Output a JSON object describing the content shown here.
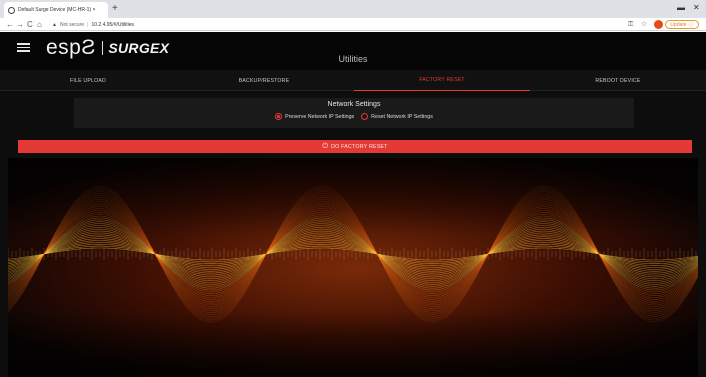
{
  "browser": {
    "tab_title": "Default Surge Device (MC-HR-1) ×",
    "tab_close": "×",
    "new_tab": "+",
    "window_min": "▬",
    "window_close": "✕",
    "nav_back": "←",
    "nav_forward": "→",
    "nav_reload": "C",
    "nav_home": "⌂",
    "security_icon": "▲",
    "security_label": "Not secure",
    "url": "10.2.4.95/#/Utilities",
    "update_label": "Update"
  },
  "header": {
    "logo_esp": "espƧ",
    "logo_surgex": "SURGEX",
    "title": "Utilities"
  },
  "nav": {
    "tabs": [
      {
        "label": "FILE UPLOAD"
      },
      {
        "label": "BACKUP/RESTORE"
      },
      {
        "label": "FACTORY RESET"
      },
      {
        "label": "REBOOT DEVICE"
      }
    ],
    "active_index": 2
  },
  "network_settings": {
    "heading": "Network Settings",
    "options": [
      {
        "label": "Preserve Network IP Settings",
        "selected": true
      },
      {
        "label": "Reset Network IP Settings",
        "selected": false
      }
    ]
  },
  "action": {
    "icon": "power-icon",
    "label": "DO FACTORY RESET"
  },
  "colors": {
    "accent": "#e53935",
    "background": "#0d0d0d",
    "wave_glow": "#ffb300"
  }
}
